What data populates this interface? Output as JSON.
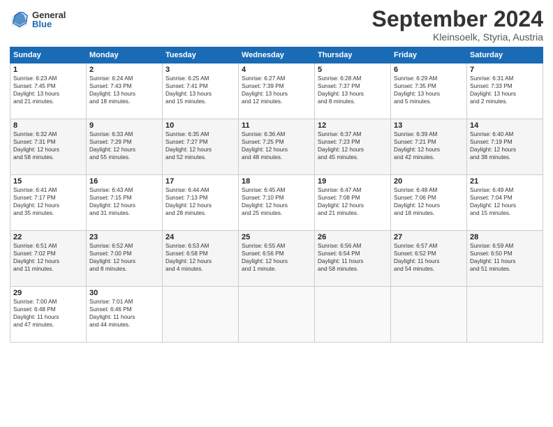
{
  "header": {
    "logo_general": "General",
    "logo_blue": "Blue",
    "month_title": "September 2024",
    "subtitle": "Kleinsoelk, Styria, Austria"
  },
  "weekdays": [
    "Sunday",
    "Monday",
    "Tuesday",
    "Wednesday",
    "Thursday",
    "Friday",
    "Saturday"
  ],
  "weeks": [
    [
      {
        "day": "1",
        "lines": [
          "Sunrise: 6:23 AM",
          "Sunset: 7:45 PM",
          "Daylight: 13 hours",
          "and 21 minutes."
        ]
      },
      {
        "day": "2",
        "lines": [
          "Sunrise: 6:24 AM",
          "Sunset: 7:43 PM",
          "Daylight: 13 hours",
          "and 18 minutes."
        ]
      },
      {
        "day": "3",
        "lines": [
          "Sunrise: 6:25 AM",
          "Sunset: 7:41 PM",
          "Daylight: 13 hours",
          "and 15 minutes."
        ]
      },
      {
        "day": "4",
        "lines": [
          "Sunrise: 6:27 AM",
          "Sunset: 7:39 PM",
          "Daylight: 13 hours",
          "and 12 minutes."
        ]
      },
      {
        "day": "5",
        "lines": [
          "Sunrise: 6:28 AM",
          "Sunset: 7:37 PM",
          "Daylight: 13 hours",
          "and 8 minutes."
        ]
      },
      {
        "day": "6",
        "lines": [
          "Sunrise: 6:29 AM",
          "Sunset: 7:35 PM",
          "Daylight: 13 hours",
          "and 5 minutes."
        ]
      },
      {
        "day": "7",
        "lines": [
          "Sunrise: 6:31 AM",
          "Sunset: 7:33 PM",
          "Daylight: 13 hours",
          "and 2 minutes."
        ]
      }
    ],
    [
      {
        "day": "8",
        "lines": [
          "Sunrise: 6:32 AM",
          "Sunset: 7:31 PM",
          "Daylight: 12 hours",
          "and 58 minutes."
        ]
      },
      {
        "day": "9",
        "lines": [
          "Sunrise: 6:33 AM",
          "Sunset: 7:29 PM",
          "Daylight: 12 hours",
          "and 55 minutes."
        ]
      },
      {
        "day": "10",
        "lines": [
          "Sunrise: 6:35 AM",
          "Sunset: 7:27 PM",
          "Daylight: 12 hours",
          "and 52 minutes."
        ]
      },
      {
        "day": "11",
        "lines": [
          "Sunrise: 6:36 AM",
          "Sunset: 7:25 PM",
          "Daylight: 12 hours",
          "and 48 minutes."
        ]
      },
      {
        "day": "12",
        "lines": [
          "Sunrise: 6:37 AM",
          "Sunset: 7:23 PM",
          "Daylight: 12 hours",
          "and 45 minutes."
        ]
      },
      {
        "day": "13",
        "lines": [
          "Sunrise: 6:39 AM",
          "Sunset: 7:21 PM",
          "Daylight: 12 hours",
          "and 42 minutes."
        ]
      },
      {
        "day": "14",
        "lines": [
          "Sunrise: 6:40 AM",
          "Sunset: 7:19 PM",
          "Daylight: 12 hours",
          "and 38 minutes."
        ]
      }
    ],
    [
      {
        "day": "15",
        "lines": [
          "Sunrise: 6:41 AM",
          "Sunset: 7:17 PM",
          "Daylight: 12 hours",
          "and 35 minutes."
        ]
      },
      {
        "day": "16",
        "lines": [
          "Sunrise: 6:43 AM",
          "Sunset: 7:15 PM",
          "Daylight: 12 hours",
          "and 31 minutes."
        ]
      },
      {
        "day": "17",
        "lines": [
          "Sunrise: 6:44 AM",
          "Sunset: 7:13 PM",
          "Daylight: 12 hours",
          "and 28 minutes."
        ]
      },
      {
        "day": "18",
        "lines": [
          "Sunrise: 6:45 AM",
          "Sunset: 7:10 PM",
          "Daylight: 12 hours",
          "and 25 minutes."
        ]
      },
      {
        "day": "19",
        "lines": [
          "Sunrise: 6:47 AM",
          "Sunset: 7:08 PM",
          "Daylight: 12 hours",
          "and 21 minutes."
        ]
      },
      {
        "day": "20",
        "lines": [
          "Sunrise: 6:48 AM",
          "Sunset: 7:06 PM",
          "Daylight: 12 hours",
          "and 18 minutes."
        ]
      },
      {
        "day": "21",
        "lines": [
          "Sunrise: 6:49 AM",
          "Sunset: 7:04 PM",
          "Daylight: 12 hours",
          "and 15 minutes."
        ]
      }
    ],
    [
      {
        "day": "22",
        "lines": [
          "Sunrise: 6:51 AM",
          "Sunset: 7:02 PM",
          "Daylight: 12 hours",
          "and 11 minutes."
        ]
      },
      {
        "day": "23",
        "lines": [
          "Sunrise: 6:52 AM",
          "Sunset: 7:00 PM",
          "Daylight: 12 hours",
          "and 8 minutes."
        ]
      },
      {
        "day": "24",
        "lines": [
          "Sunrise: 6:53 AM",
          "Sunset: 6:58 PM",
          "Daylight: 12 hours",
          "and 4 minutes."
        ]
      },
      {
        "day": "25",
        "lines": [
          "Sunrise: 6:55 AM",
          "Sunset: 6:56 PM",
          "Daylight: 12 hours",
          "and 1 minute."
        ]
      },
      {
        "day": "26",
        "lines": [
          "Sunrise: 6:56 AM",
          "Sunset: 6:54 PM",
          "Daylight: 11 hours",
          "and 58 minutes."
        ]
      },
      {
        "day": "27",
        "lines": [
          "Sunrise: 6:57 AM",
          "Sunset: 6:52 PM",
          "Daylight: 11 hours",
          "and 54 minutes."
        ]
      },
      {
        "day": "28",
        "lines": [
          "Sunrise: 6:59 AM",
          "Sunset: 6:50 PM",
          "Daylight: 11 hours",
          "and 51 minutes."
        ]
      }
    ],
    [
      {
        "day": "29",
        "lines": [
          "Sunrise: 7:00 AM",
          "Sunset: 6:48 PM",
          "Daylight: 11 hours",
          "and 47 minutes."
        ]
      },
      {
        "day": "30",
        "lines": [
          "Sunrise: 7:01 AM",
          "Sunset: 6:46 PM",
          "Daylight: 11 hours",
          "and 44 minutes."
        ]
      },
      {
        "day": "",
        "lines": []
      },
      {
        "day": "",
        "lines": []
      },
      {
        "day": "",
        "lines": []
      },
      {
        "day": "",
        "lines": []
      },
      {
        "day": "",
        "lines": []
      }
    ]
  ]
}
